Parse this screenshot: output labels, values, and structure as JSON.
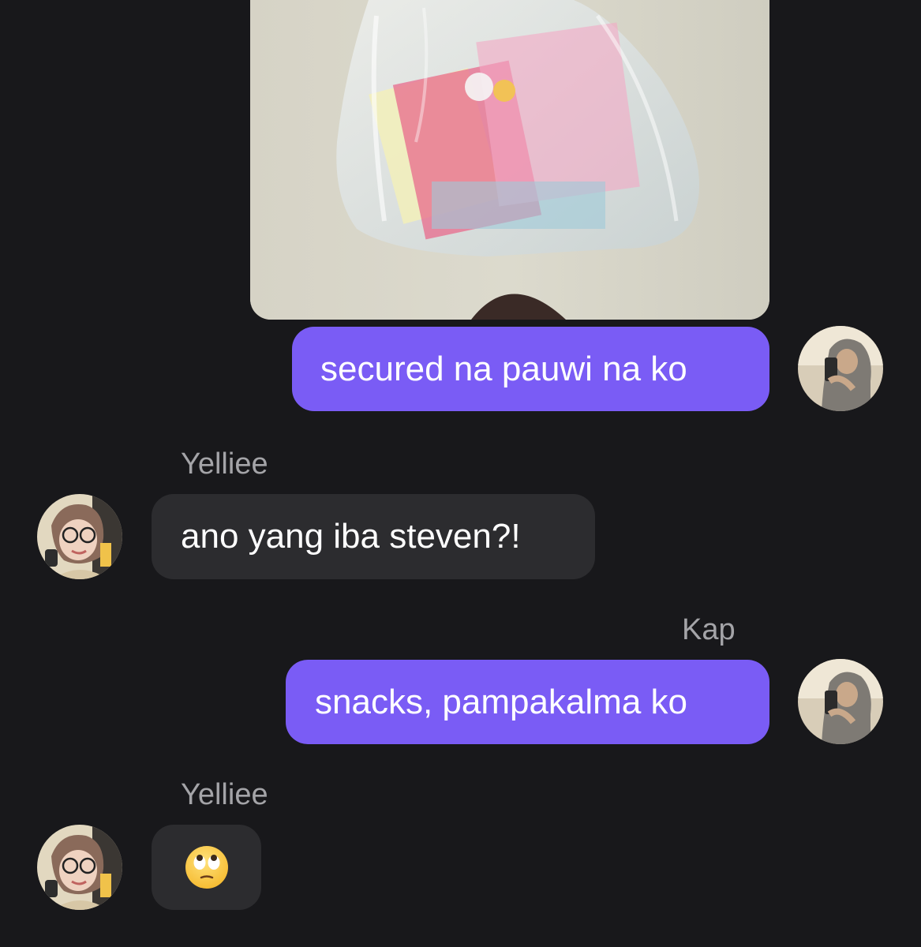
{
  "messages": [
    {
      "id": 1,
      "direction": "outgoing",
      "type": "photo",
      "description_icon": "photo-of-plastic-bag"
    },
    {
      "id": 2,
      "direction": "outgoing",
      "type": "text",
      "text": "secured na pauwi na ko"
    },
    {
      "id": 3,
      "direction": "incoming",
      "sender": "Yelliee",
      "type": "text",
      "text": "ano yang iba steven?!"
    },
    {
      "id": 4,
      "direction": "outgoing",
      "sender": "Kap",
      "type": "text",
      "text": "snacks, pampakalma ko"
    },
    {
      "id": 5,
      "direction": "incoming",
      "sender": "Yelliee",
      "type": "emoji",
      "emoji": "face-with-rolling-eyes-icon"
    }
  ],
  "colors": {
    "background": "#18181b",
    "outgoing_bubble": "#7a5cf5",
    "incoming_bubble": "#2c2c2f",
    "sender_name": "#a4a4a8",
    "text": "#ffffff"
  }
}
